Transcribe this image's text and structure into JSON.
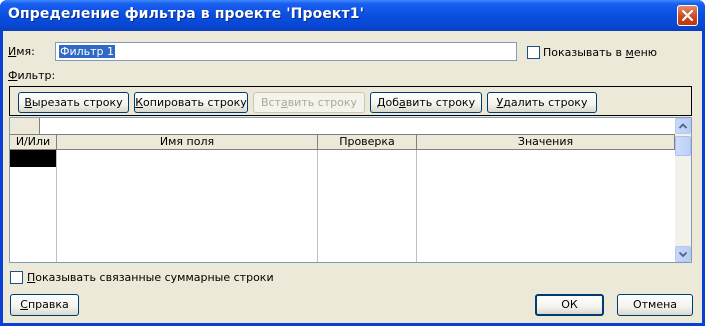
{
  "window": {
    "title": "Определение фильтра в проекте 'Проект1'"
  },
  "name_field": {
    "label_underlined": "И",
    "label_rest": "мя:",
    "value": "Фильтр 1"
  },
  "show_in_menu": {
    "label_before": "Показывать в ",
    "label_underlined": "м",
    "label_after": "еню",
    "checked": false
  },
  "filter_label": {
    "label_underlined": "Ф",
    "label_rest": "ильтр:"
  },
  "toolbar": {
    "cut_row": {
      "underlined": "В",
      "rest": "ырезать строку"
    },
    "copy_row": {
      "underlined": "К",
      "rest": "опировать строку"
    },
    "paste_row": {
      "before": "Вст",
      "underlined": "а",
      "after": "вить строку",
      "disabled": true
    },
    "add_row": {
      "before": "Доб",
      "underlined": "а",
      "after": "вить строку"
    },
    "delete_row": {
      "underlined": "У",
      "rest": "далить строку"
    }
  },
  "table": {
    "columns": [
      "И/Или",
      "Имя поля",
      "Проверка",
      "Значения"
    ],
    "rows": []
  },
  "show_summary_rows": {
    "label_underlined": "П",
    "label_rest": "оказывать связанные суммарные строки",
    "checked": false
  },
  "buttons": {
    "help": {
      "underlined": "С",
      "rest": "правка"
    },
    "ok": "ОК",
    "cancel": "Отмена"
  }
}
